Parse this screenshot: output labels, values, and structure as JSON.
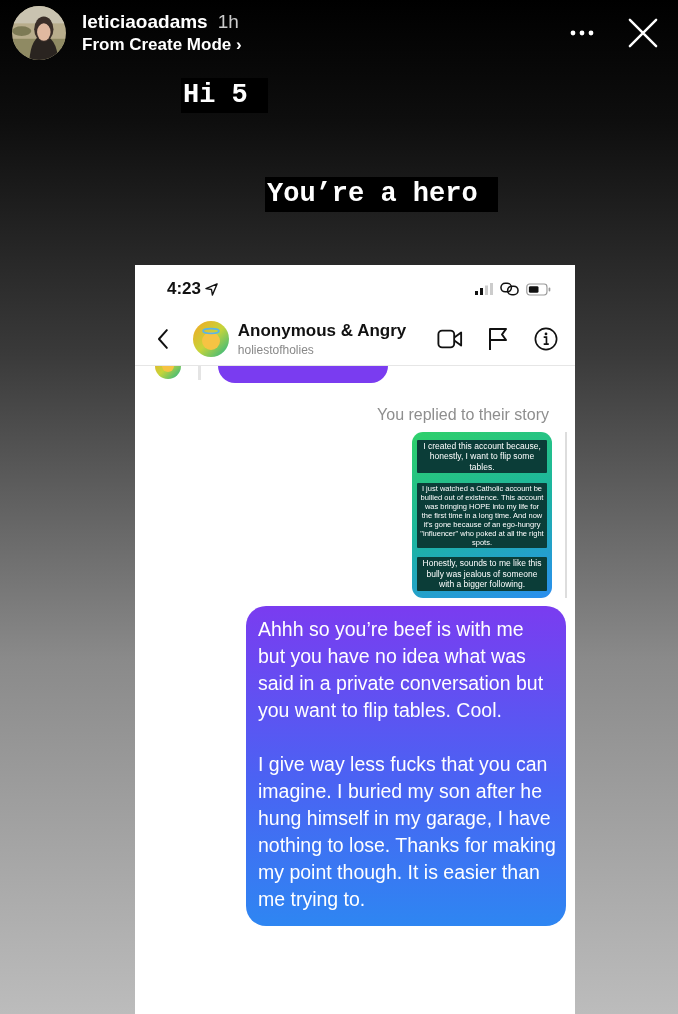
{
  "story_header": {
    "username": "leticiaoadams",
    "time": "1h",
    "subtitle": "From Create Mode ›"
  },
  "stickers": [
    "Hi 5",
    "You’re a hero"
  ],
  "screenshot": {
    "status_bar": {
      "time": "4:23"
    },
    "chat": {
      "name": "Anonymous & Angry",
      "handle": "holiestofholies"
    },
    "reply_note": "You replied to their story",
    "story_preview": {
      "blocks": [
        {
          "kind": "large",
          "text": "I created this account because, honestly, I want to flip some tables."
        },
        {
          "kind": "small",
          "text": "I just watched a Catholic account be bullied out of existence. This account was bringing HOPE into my life for the first time in a long time. And now it's gone because of an ego-hungry \"influencer\" who poked at all the right spots."
        },
        {
          "kind": "large",
          "text": "Honestly, sounds to me like this bully was jealous of someone with a bigger following."
        }
      ]
    },
    "message": {
      "paragraphs": [
        "Ahhh so you’re beef is with me but you have no idea what was said in a private conversation but you want to flip tables. Cool.",
        "I give way less fucks that you can imagine. I buried my son after he hung himself in my garage, I have nothing to lose. Thanks for making my point though. It is easier than me trying to."
      ]
    }
  }
}
